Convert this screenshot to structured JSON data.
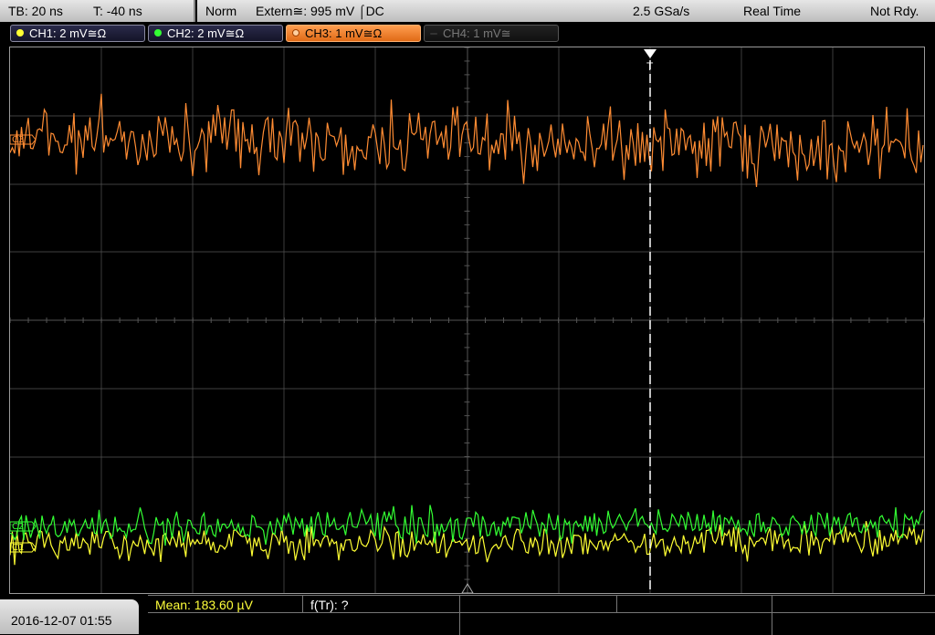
{
  "status": {
    "timebase": "TB: 20 ns",
    "trigger_time": "T: -40 ns",
    "trigger_mode": "Norm",
    "trigger_source": "Extern≅: 995 mV ⌠DC",
    "sample_rate": "2.5 GSa/s",
    "acq_mode": "Real Time",
    "state": "Not Rdy."
  },
  "channels": [
    {
      "label": "CH1: 2 mV≅Ω",
      "color": "#ffff33",
      "state": "on"
    },
    {
      "label": "CH2: 2 mV≅Ω",
      "color": "#33ff33",
      "state": "on"
    },
    {
      "label": "CH3: 1 mV≅Ω",
      "color": "#ff8c33",
      "state": "selected"
    },
    {
      "label": "CH4: 1 mV≅",
      "color": "#666666",
      "state": "off"
    }
  ],
  "markers": {
    "trigger": "T",
    "ch3": "C3",
    "ch2": "C2",
    "ch1": "C1"
  },
  "bottom": {
    "datetime": "2016-12-07 01:55",
    "mean": "Mean: 183.60 µV",
    "ftr": "f(Tr): ?"
  },
  "colors": {
    "ch1": "#ffff33",
    "ch2": "#33ff33",
    "ch3": "#ff8c33",
    "grid": "#555555"
  }
}
